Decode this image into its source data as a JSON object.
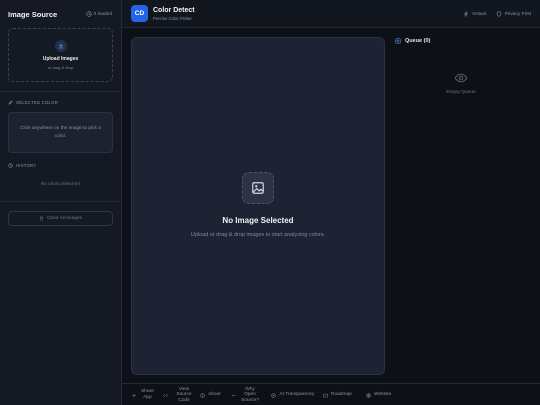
{
  "sidebar": {
    "title": "Image Source",
    "loaded_count": "0 loaded",
    "upload": {
      "title": "Upload Images",
      "subtitle": "or drag & drop"
    },
    "selected_color": {
      "label": "SELECTED COLOR",
      "hint": "Click anywhere on the image to pick a color."
    },
    "history": {
      "label": "HISTORY",
      "empty": "No colors picked yet"
    },
    "clear_button": "Clear All Images"
  },
  "header": {
    "logo_text": "CD",
    "title": "Color Detect",
    "subtitle": "Precise Color Picker",
    "badges": [
      "Instant",
      "Privacy First"
    ]
  },
  "main": {
    "empty_title": "No Image Selected",
    "empty_subtitle": "Upload or drag & drop images to start analyzing colors."
  },
  "queue": {
    "title": "Queue (0)",
    "empty": "Empty Queue"
  },
  "footer": {
    "share": "Share App",
    "source": "View Source Code",
    "about": "About",
    "open_source": "Why Open Source?",
    "ai": "AI Transparency",
    "roadmap": "Roadmap",
    "website": "Website"
  },
  "colors": {
    "accent": "#2563eb",
    "background": "#0d1117",
    "panel": "#1e2334",
    "sidebar": "#141923"
  },
  "icons": [
    "clock-icon",
    "upload-icon",
    "pencil-icon",
    "history-icon",
    "trash-icon",
    "lightning-icon",
    "shield-icon",
    "image-icon",
    "queue-icon",
    "eye-icon",
    "share-icon",
    "code-icon",
    "info-icon",
    "open-source-icon",
    "ai-icon",
    "roadmap-icon",
    "globe-icon"
  ]
}
